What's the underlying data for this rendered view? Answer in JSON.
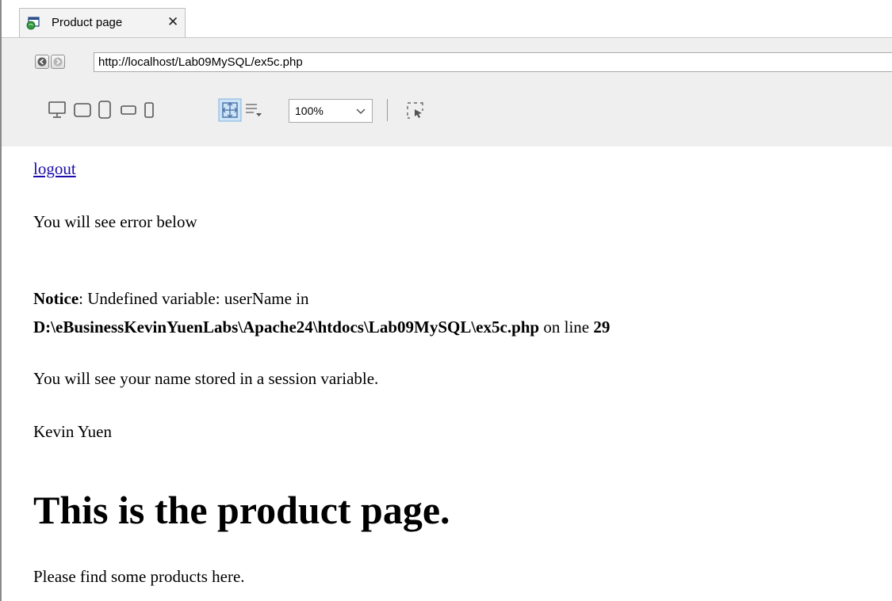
{
  "tab": {
    "title": "Product page",
    "close": "✕",
    "icon": "page-window-icon"
  },
  "toolbar": {
    "url": "http://localhost/Lab09MySQL/ex5c.php",
    "zoom": "100%",
    "back_icon": "back-arrow-icon",
    "forward_icon": "forward-arrow-icon",
    "device_icons": [
      "desktop-icon",
      "tablet-landscape-icon",
      "tablet-portrait-icon",
      "phone-landscape-icon",
      "phone-portrait-icon",
      "fit-to-window-icon",
      "text-wrap-icon",
      "select-region-icon"
    ]
  },
  "page": {
    "logout": "logout",
    "error_intro": "You will see error below",
    "notice_label": "Notice",
    "notice_text": ": Undefined variable: userName in",
    "notice_path": "D:\\eBusinessKevinYuenLabs\\Apache24\\htdocs\\Lab09MySQL\\ex5c.php",
    "notice_online": " on line ",
    "notice_line": "29",
    "session_text": "You will see your name stored in a session variable.",
    "user_name": "Kevin Yuen",
    "heading": "This is the product page.",
    "products_text": "Please find some products here."
  },
  "colors": {
    "link": "#1a0dab",
    "toolbar_bg": "#efefef",
    "active_tool": "#cce4f7"
  }
}
